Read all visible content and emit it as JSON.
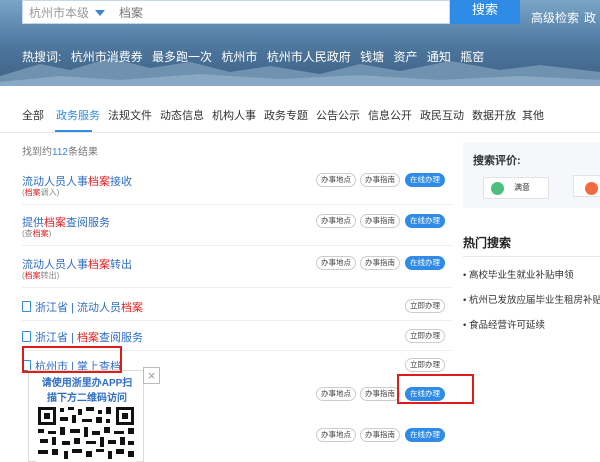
{
  "header": {
    "scope_value": "杭州市本级",
    "search_placeholder": "档案",
    "search_button": "搜索",
    "advanced_search": "高级检索",
    "advanced_search_cut": "政",
    "hotwords_label": "热搜词:",
    "hotwords": [
      "杭州市消费券",
      "最多跑一次",
      "杭州市",
      "杭州市人民政府",
      "钱塘",
      "资产",
      "通知",
      "瓶窑"
    ]
  },
  "nav": {
    "tabs": [
      "全部",
      "政务服务",
      "法规文件",
      "动态信息",
      "机构人事",
      "政务专题",
      "公告公示",
      "信息公开",
      "政民互动",
      "数据开放",
      "其他"
    ],
    "active_index": 1
  },
  "results": {
    "count_prefix": "找到约",
    "count": "112",
    "count_suffix": "条结果"
  },
  "rows": [
    {
      "title_pre": "流动人员人事",
      "title_hl": "档案",
      "title_post": "接收",
      "sub_pre": "(",
      "sub_hl": "档案",
      "sub_post": "调入)"
    },
    {
      "title_pre": "提供",
      "title_hl": "档案",
      "title_post": "查阅服务",
      "sub_pre": "(查",
      "sub_hl": "档案",
      "sub_post": ")"
    },
    {
      "title_pre": "流动人员人事",
      "title_hl": "档案",
      "title_post": "转出",
      "sub_pre": "(",
      "sub_hl": "档案",
      "sub_post": "转出)"
    },
    {
      "title_pre": "浙江省 | 流动人员",
      "title_hl": "档案",
      "title_post": ""
    },
    {
      "title_pre": "浙江省 | ",
      "title_hl": "档案",
      "title_post": "查阅服务"
    },
    {
      "title_pre": "杭州市 | 掌上查档",
      "title_hl": "",
      "title_post": ""
    }
  ],
  "buttons": {
    "office_location": "办事地点",
    "office_guide": "办事指南",
    "handle_online": "在线办理",
    "handle_now": "立即办理"
  },
  "side": {
    "eval_title": "搜索评价:",
    "satisfied": "满意",
    "hot_title": "热门搜索",
    "hot_items": [
      "高校毕业生就业补贴申领",
      "杭州已发放应届毕业生租房补贴超",
      "食品经营许可延续"
    ]
  },
  "qr": {
    "line1": "请使用浙里办APP扫",
    "line2": "描下方二维码访问",
    "close": "×"
  },
  "colors": {
    "accent": "#2f8be6",
    "highlight": "#e02020",
    "annotation": "#e01b1b"
  }
}
